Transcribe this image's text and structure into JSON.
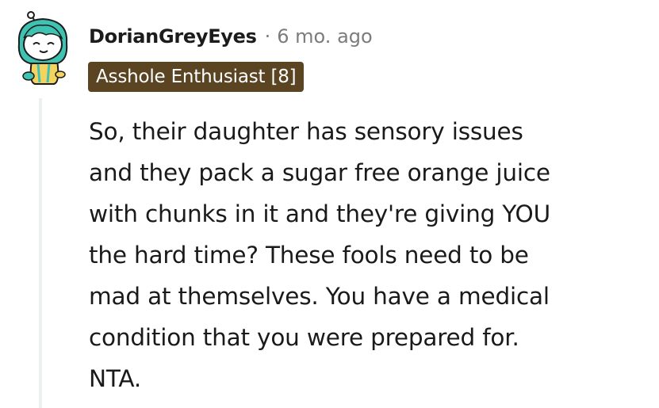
{
  "comment": {
    "username": "DorianGreyEyes",
    "separator": "·",
    "timestamp": "6 mo. ago",
    "flair": "Asshole Enthusiast [8]",
    "body_lines": [
      "So, their daughter has sensory issues",
      "and they pack a sugar free orange juice",
      "with chunks in it and they're giving YOU",
      "the hard time? These fools need to be",
      "mad at themselves. You have a medical",
      "condition that you were prepared for.",
      "NTA."
    ]
  },
  "colors": {
    "flair_background": "#5a4422",
    "flair_text": "#ffffff",
    "timestamp": "#7c7c7c",
    "thread_line": "#edeff1",
    "avatar_hair": "#3fc2b1",
    "avatar_body": "#f4d35e"
  },
  "icons": {
    "avatar": "snoo-avatar-icon"
  }
}
